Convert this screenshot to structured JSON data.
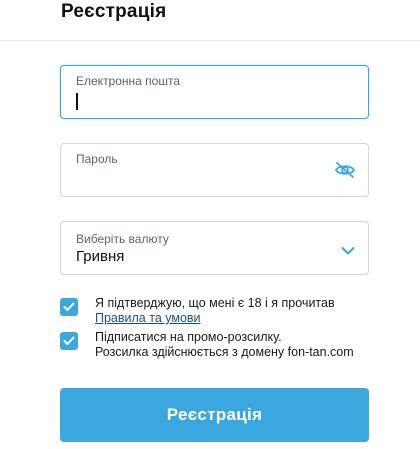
{
  "page": {
    "title": "Реєстрація"
  },
  "form": {
    "email": {
      "label": "Електронна пошта",
      "value": ""
    },
    "password": {
      "label": "Пароль",
      "value": "",
      "toggle_icon": "eye-off-icon"
    },
    "currency": {
      "label": "Виберіть валюту",
      "value": "Гривня",
      "icon": "chevron-down-icon"
    },
    "terms": {
      "checked": true,
      "text": "Я підтверджую, що мені є 18 і я прочитав",
      "link": "Правила та умови"
    },
    "promo": {
      "checked": true,
      "line1": "Підписатися на промо-розсилку.",
      "line2": "Розсилка здійснюється з домену fon-tan.com"
    },
    "submit_label": "Реєстрація"
  },
  "colors": {
    "accent": "#3aa7de",
    "link": "#1d4f8c",
    "border": "#d3d6da"
  }
}
